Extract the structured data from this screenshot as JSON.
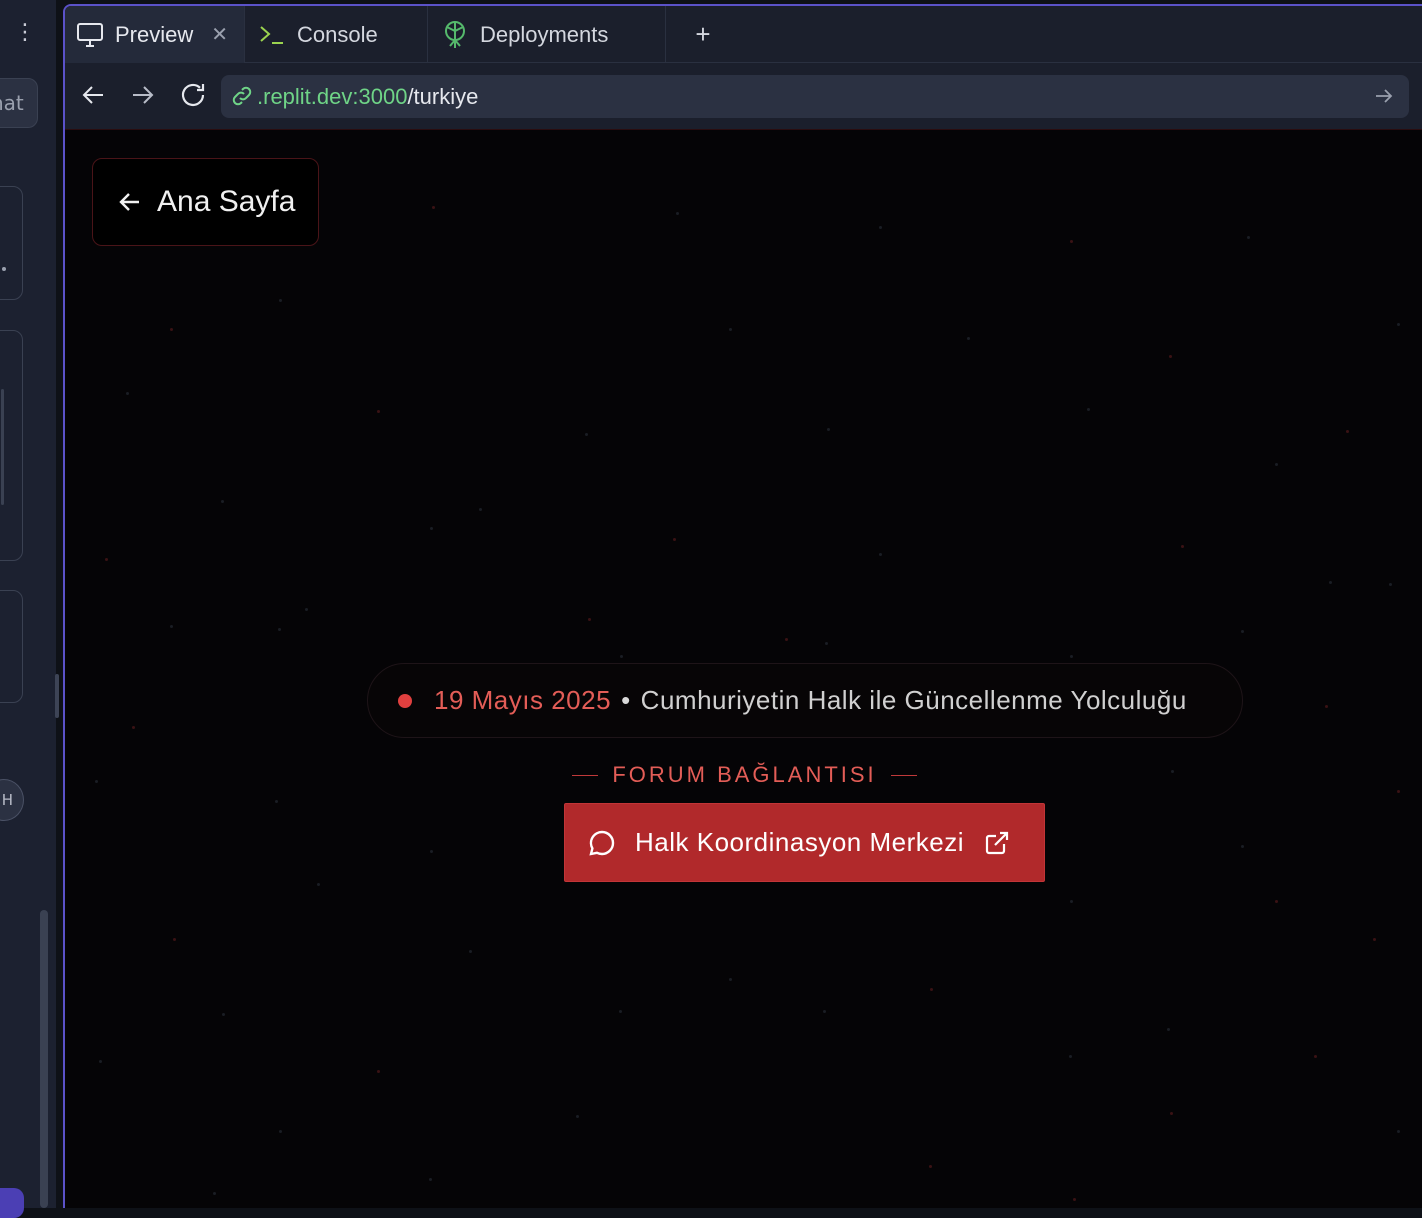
{
  "left_panel": {
    "chat_label": "hat",
    "avatar_initial": "H"
  },
  "tabs": [
    {
      "label": "Preview",
      "icon": "monitor-icon",
      "active": true
    },
    {
      "label": "Console",
      "icon": "terminal-icon",
      "active": false
    },
    {
      "label": "Deployments",
      "icon": "deployments-icon",
      "active": false
    }
  ],
  "tab_add_label": "+",
  "address_bar": {
    "host": ".replit.dev:3000",
    "path": "/turkiye",
    "host_color": "#6fd487"
  },
  "site": {
    "back_button_label": "Ana Sayfa",
    "date": "19 Mayıs 2025",
    "separator": "•",
    "slogan": "Cumhuriyetin Halk ile Güncellenme Yolculuğu",
    "section_label": "FORUM BAĞLANTISI",
    "cta_label": "Halk Koordinasyon Merkezi",
    "accent_color": "#e35d57",
    "cta_color": "#b1292b"
  }
}
